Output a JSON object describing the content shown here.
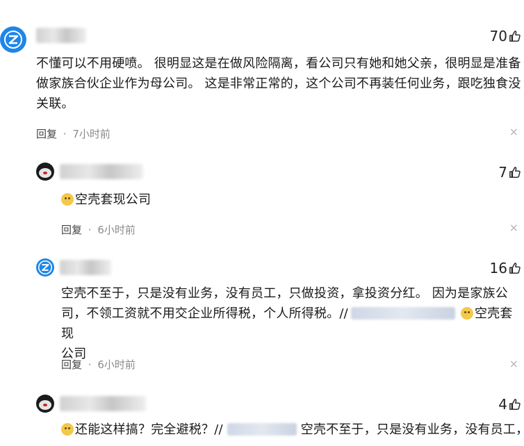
{
  "comments": [
    {
      "likes": "70",
      "text_lines": [
        "不懂可以不用硬喷。 很明显这是在做风险隔离，看公司只有她和她父亲，很明显是准备",
        "做家族合伙企业作为母公司。 这是非常正常的，这个公司不再装任何业务，跟吃独食没",
        "关联。"
      ],
      "reply_label": "回复",
      "time": "7小时前",
      "close": "×"
    },
    {
      "likes": "7",
      "text": "空壳套现公司",
      "reply_label": "回复",
      "time": "6小时前",
      "close": "×"
    },
    {
      "likes": "16",
      "text_lines": [
        "空壳不至于，只是没有业务，没有员工，只做投资，拿投资分红。 因为是家族公",
        "司，不领工资就不用交企业所得税，个人所得税。//",
        "公司"
      ],
      "line2_tail": "空壳套现",
      "reply_label": "回复",
      "time": "6小时前",
      "close": "×"
    },
    {
      "likes": "4",
      "text_a": "还能这样搞？完全避税？//",
      "text_b": "空壳不至于，只是没有业务，没有员工，"
    }
  ],
  "sep": "·",
  "colors": {
    "brand_blue": "#1e86e8",
    "meta_gray": "#8a8a8a"
  },
  "icons": [
    "zhihu-z-icon",
    "bear-avatar-icon",
    "thumbs-up-icon",
    "close-icon",
    "doge-emoji-icon"
  ]
}
